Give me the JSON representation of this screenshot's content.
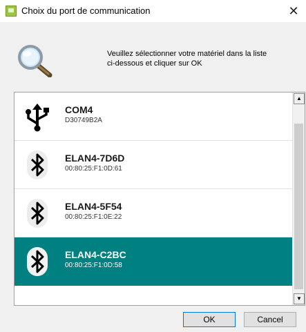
{
  "window": {
    "title": "Choix du port de communication",
    "close_glyph": "✕"
  },
  "header": {
    "icon": "magnifier-icon",
    "instruction_line1": "Veuillez sélectionner votre matériel dans la liste",
    "instruction_line2": "ci-dessous et cliquer sur OK"
  },
  "devices": [
    {
      "name": "COM4",
      "id": "D30749B2A",
      "icon": "usb-icon"
    },
    {
      "name": "ELAN4-7D6D",
      "id": "00:80:25:F1:0D:61",
      "icon": "bluetooth-icon"
    },
    {
      "name": "ELAN4-5F54",
      "id": "00:80:25:F1:0E:22",
      "icon": "bluetooth-icon"
    },
    {
      "name": "ELAN4-C2BC",
      "id": "00:80:25:F1:0D:58",
      "icon": "bluetooth-icon",
      "selected": true
    }
  ],
  "scrollbar": {
    "up_glyph": "▲",
    "down_glyph": "▼"
  },
  "buttons": {
    "ok": "OK",
    "cancel": "Cancel"
  },
  "colors": {
    "selection": "#008080",
    "app_icon": "#9bc83a"
  }
}
